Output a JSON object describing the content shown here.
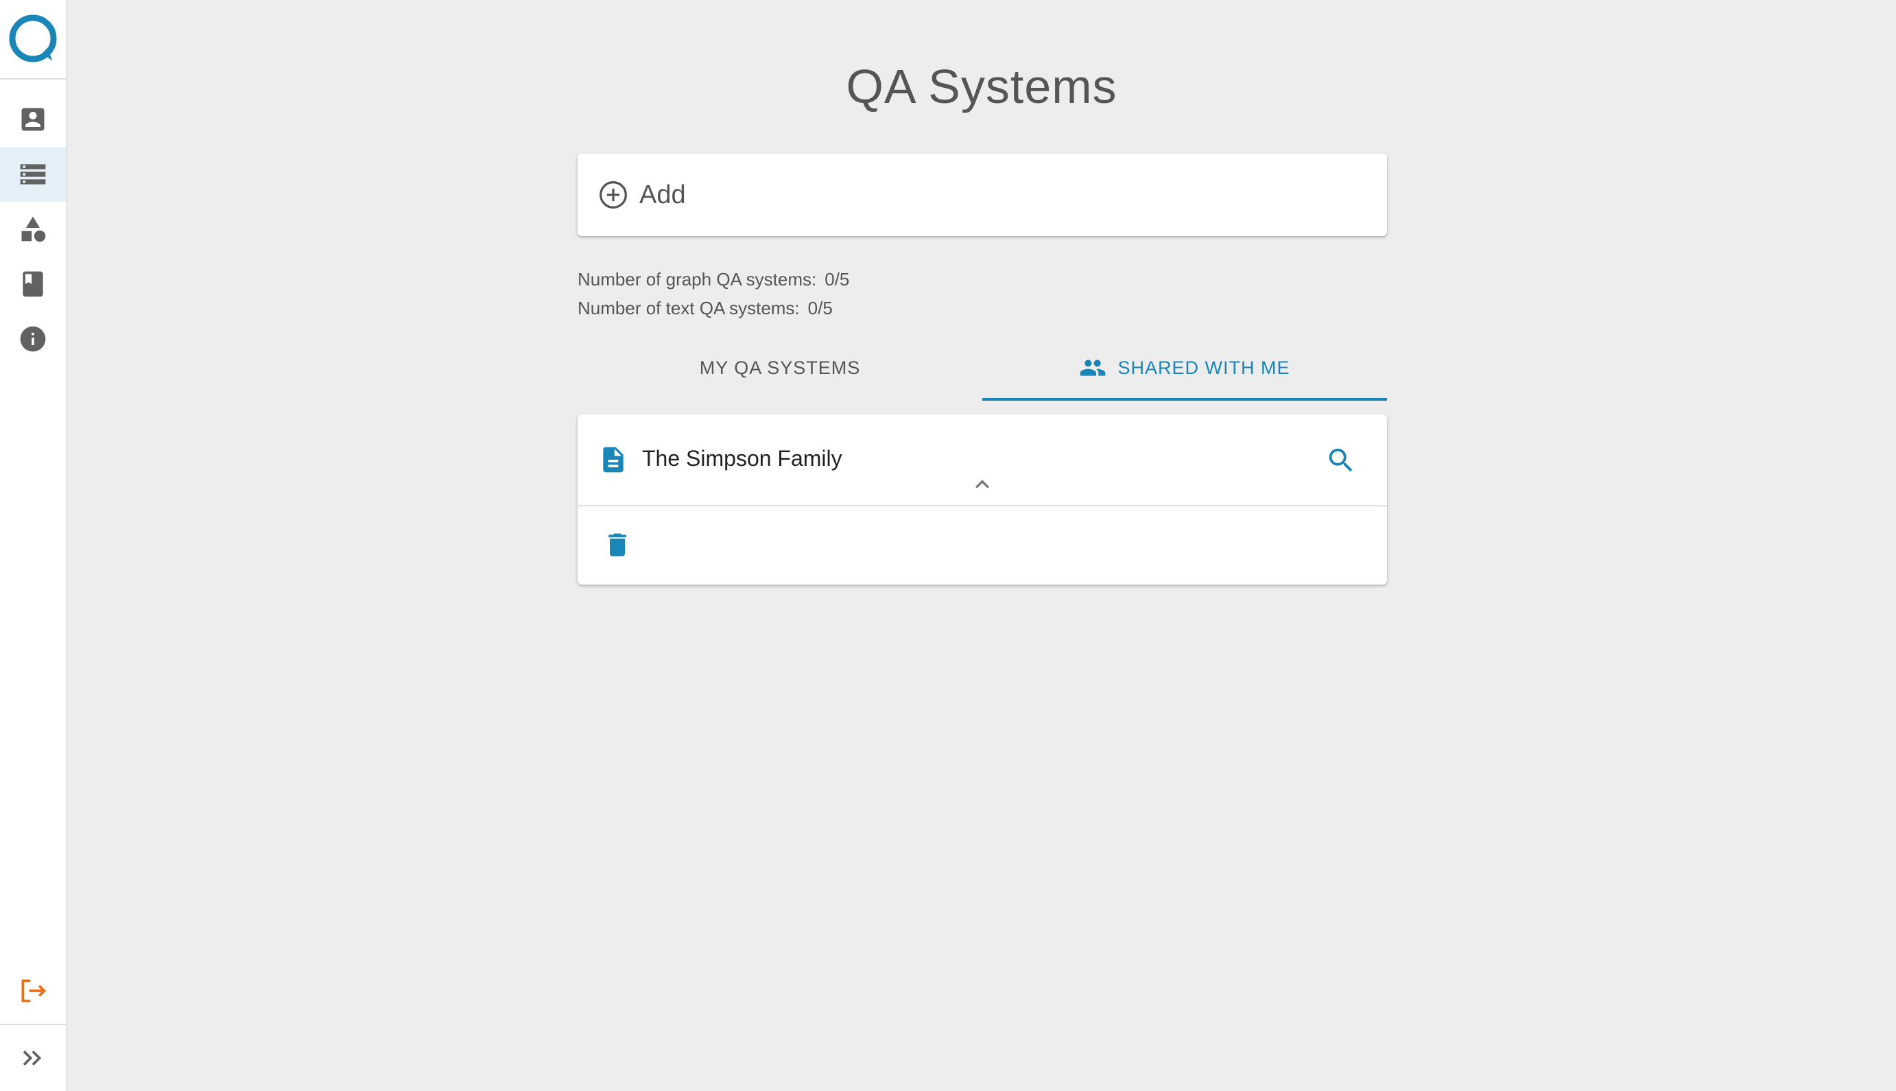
{
  "app": {
    "page_title": "QA Systems",
    "brand_color": "#1a86b8",
    "accent_logout_color": "#e8701a"
  },
  "sidebar": {
    "logo_icon": "logo-ring-icon",
    "items": [
      {
        "icon": "account-box-icon",
        "active": false
      },
      {
        "icon": "storage-icon",
        "active": true
      },
      {
        "icon": "category-shapes-icon",
        "active": false
      },
      {
        "icon": "book-icon",
        "active": false
      },
      {
        "icon": "info-icon",
        "active": false
      }
    ],
    "logout_icon": "logout-icon",
    "expand_icon": "double-chevron-right-icon"
  },
  "add_card": {
    "icon": "add-circle-icon",
    "label": "Add"
  },
  "counts": {
    "graph_label": "Number of graph QA systems:",
    "graph_value": "0/5",
    "text_label": "Number of text QA systems:",
    "text_value": "0/5"
  },
  "tabs": [
    {
      "label": "MY QA SYSTEMS",
      "active": false
    },
    {
      "label": "SHARED WITH ME",
      "icon": "people-icon",
      "active": true
    }
  ],
  "qa_systems": [
    {
      "name": "The Simpson Family",
      "type_icon": "text-document-icon",
      "expanded": true,
      "actions": [
        "search-icon",
        "delete-icon"
      ]
    }
  ]
}
